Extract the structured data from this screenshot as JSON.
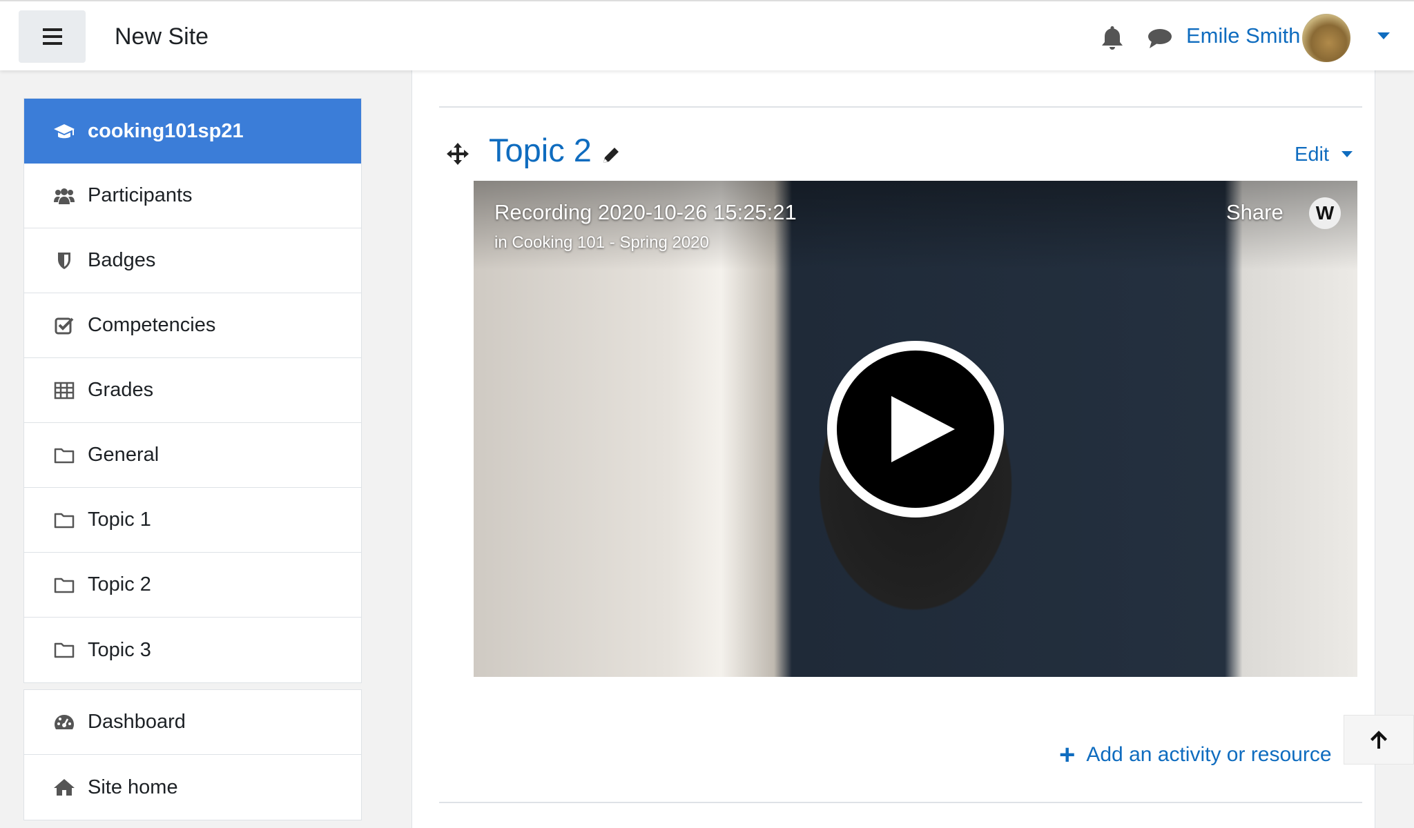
{
  "header": {
    "site_name": "New Site",
    "user_name": "Emile Smith"
  },
  "nav": {
    "course": [
      {
        "label": "cooking101sp21",
        "icon": "graduation-cap-icon",
        "active": true
      },
      {
        "label": "Participants",
        "icon": "users-icon"
      },
      {
        "label": "Badges",
        "icon": "shield-icon"
      },
      {
        "label": "Competencies",
        "icon": "check-square-icon"
      },
      {
        "label": "Grades",
        "icon": "table-icon"
      },
      {
        "label": "General",
        "icon": "folder-icon"
      },
      {
        "label": "Topic 1",
        "icon": "folder-icon"
      },
      {
        "label": "Topic 2",
        "icon": "folder-icon"
      },
      {
        "label": "Topic 3",
        "icon": "folder-icon"
      }
    ],
    "site": [
      {
        "label": "Dashboard",
        "icon": "dashboard-icon"
      },
      {
        "label": "Site home",
        "icon": "home-icon"
      }
    ]
  },
  "main": {
    "section_title": "Topic 2",
    "edit_label": "Edit",
    "video": {
      "title": "Recording 2020-10-26 15:25:21",
      "subtitle": "in Cooking 101 - Spring 2020",
      "share_label": "Share",
      "logo_letter": "W"
    },
    "add_activity_label": "Add an activity or resource"
  },
  "colors": {
    "accent": "#0f6cbf",
    "active_nav": "#3b7dd8"
  }
}
